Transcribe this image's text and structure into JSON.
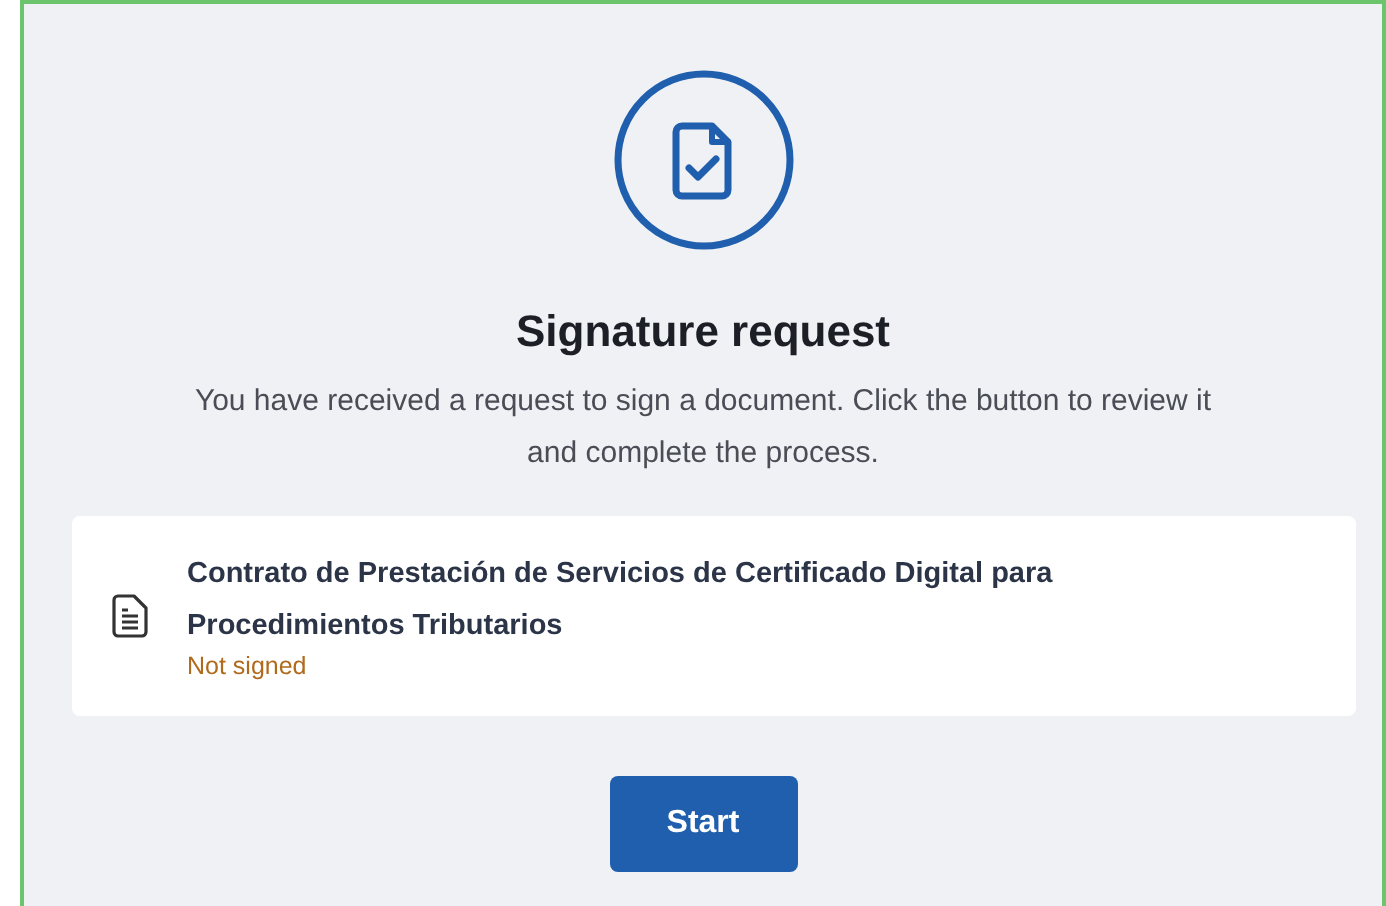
{
  "title": "Signature request",
  "description": "You have received a request to sign a document. Click the button to review it and complete the process.",
  "document": {
    "name": "Contrato de Prestación de Servicios de Certificado Digital para Procedimientos Tributarios",
    "status": "Not signed"
  },
  "button": "Start"
}
